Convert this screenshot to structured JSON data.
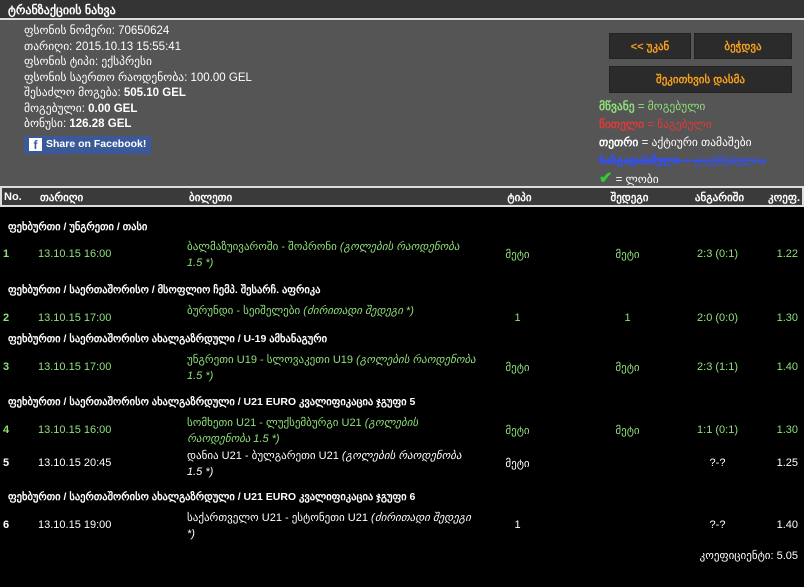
{
  "title": "ტრანზაქციის ნახვა",
  "info": {
    "bet_number_label": "ფსონის ნომერი:",
    "bet_number": "70650624",
    "date_label": "თარიღი:",
    "date": "2015.10.13 15:55:41",
    "type_label": "ფსონის ტიპი:",
    "type": "ექსპრესი",
    "amount_label": "ფსონის საერთო რაოდენობა:",
    "amount": "100.00 GEL",
    "possible_win_label": "შესაძლო მოგება:",
    "possible_win": "505.10 GEL",
    "won_label": "მოგებული:",
    "won": "0.00 GEL",
    "bonus_label": "ბონუსი:",
    "bonus": "126.28 GEL",
    "share": "Share on Facebook!"
  },
  "buttons": {
    "back": "<< უკან",
    "print": "ბეჭდვა",
    "ask": "შეკითხვის დასმა"
  },
  "legend": {
    "green": "მწვანე",
    "green_desc": "= მოგებული",
    "red": "წითელი",
    "red_desc": "= წაგებული",
    "white": "თეთრი",
    "white_desc": "= აქტიური თამაშები",
    "strike": "ხაზგადასმული",
    "strike_desc": "= გაუქმებულია",
    "check_desc": "= ლობი"
  },
  "columns": {
    "no": "No.",
    "date": "თარიღი",
    "ticket": "ბილეთი",
    "type": "ტიპი",
    "result": "შედეგი",
    "score": "ანგარიში",
    "coef": "კოეფ."
  },
  "categories": [
    "ფეხბურთი / უნგრეთი / თასი",
    "ფეხბურთი / საერთაშორისო / მსოფლიო ჩემპ. შესარჩ. აფრიკა",
    "ფეხბურთი / საერთაშორისო ახალგაზრდული / U-19 ამხანაგური",
    "ფეხბურთი / საერთაშორისო ახალგაზრდული / U21 EURO კვალიფიკაცია ჯგუფი 5",
    "ფეხბურთი / საერთაშორისო ახალგაზრდული / U21 EURO კვალიფიკაცია ჯგუფი 6"
  ],
  "rows": [
    {
      "no": "1",
      "date": "13.10.15 16:00",
      "match": "ბალმაზუივაროში - შოპრონი",
      "market": "(გოლების რაოდენობა 1.5 *)",
      "type": "მეტი",
      "result": "მეტი",
      "score": "2:3 (0:1)",
      "coef": "1.22"
    },
    {
      "no": "2",
      "date": "13.10.15 17:00",
      "match": "ბურუნდი - სეიშელები",
      "market": "(ძირითადი შედეგი *)",
      "type": "1",
      "result": "1",
      "score": "2:0 (0:0)",
      "coef": "1.30"
    },
    {
      "no": "3",
      "date": "13.10.15 17:00",
      "match": "უნგრეთი U19 - სლოვაკეთი U19",
      "market": "(გოლების რაოდენობა 1.5 *)",
      "type": "მეტი",
      "result": "მეტი",
      "score": "2:3 (1:1)",
      "coef": "1.40"
    },
    {
      "no": "4",
      "date": "13.10.15 16:00",
      "match": "სომხეთი U21 - ლუქსემბურგი U21",
      "market": "(გოლების რაოდენობა 1.5 *)",
      "type": "მეტი",
      "result": "მეტი",
      "score": "1:1 (0:1)",
      "coef": "1.30"
    },
    {
      "no": "5",
      "date": "13.10.15 20:45",
      "match": "დანია U21 - ბულგარეთი U21",
      "market": "(გოლების რაოდენობა 1.5 *)",
      "type": "მეტი",
      "result": "",
      "score": "?-?",
      "coef": "1.25"
    },
    {
      "no": "6",
      "date": "13.10.15 19:00",
      "match": "საქართველო U21 - ესტონეთი U21",
      "market": "(ძირითადი შედეგი *)",
      "type": "1",
      "result": "",
      "score": "?-?",
      "coef": "1.40"
    }
  ],
  "total_label": "კოეფიციენტი:",
  "total": "5.05",
  "colors": {
    "won": "#8fe07a",
    "lost": "#e03a3a",
    "active": "#ffffff",
    "cancelled": "#3050ff",
    "button_text": "#f7a01c"
  }
}
